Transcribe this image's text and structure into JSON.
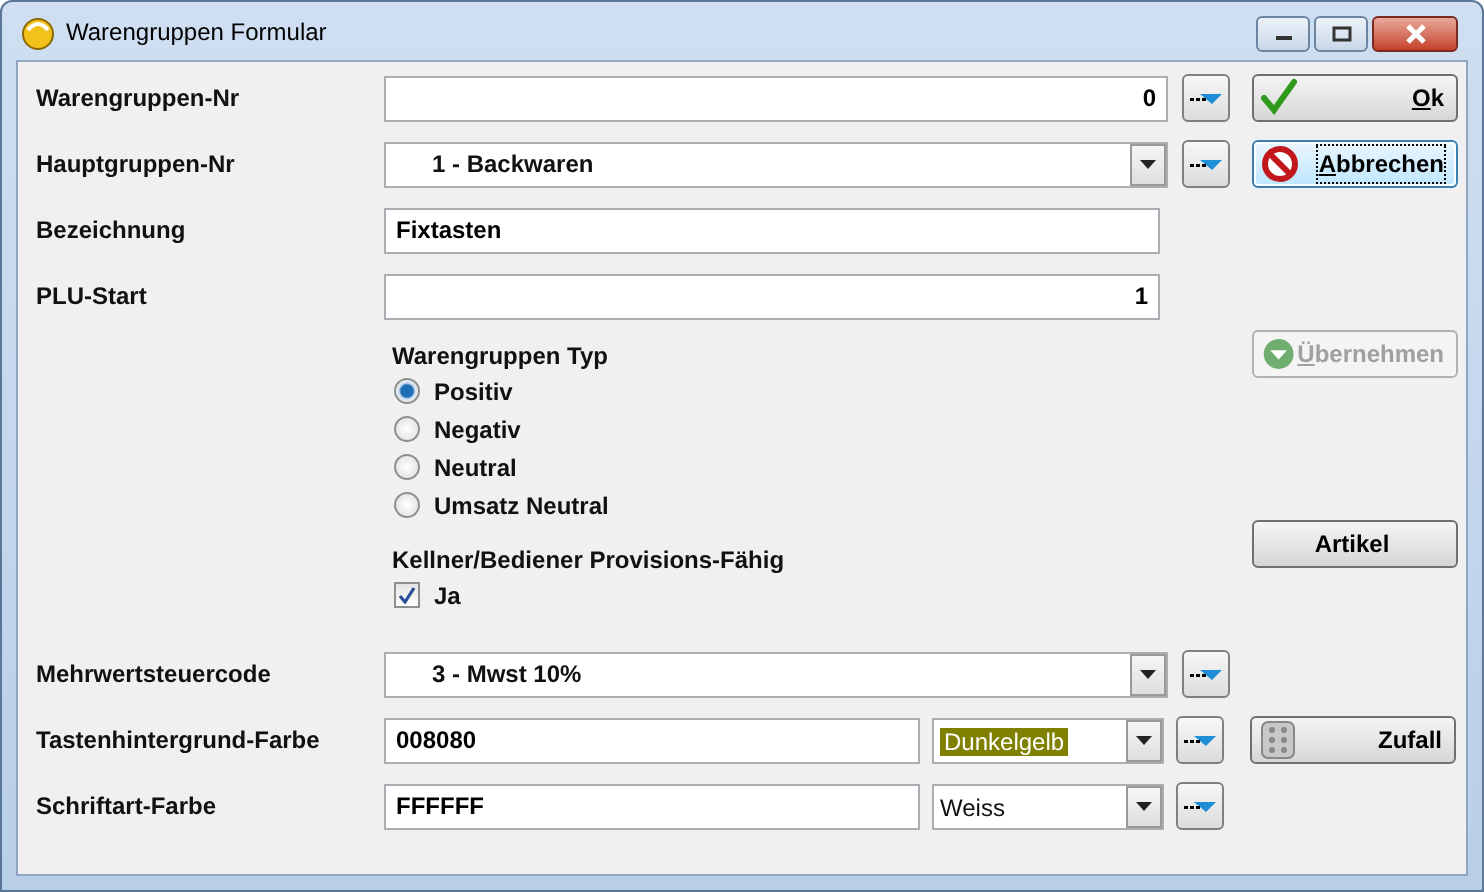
{
  "window": {
    "title": "Warengruppen Formular"
  },
  "top_rows": [
    {
      "label": "Warengruppen-Nr",
      "fields": [
        {
          "kind": "number",
          "value": "0"
        }
      ],
      "lookup": true,
      "button": {
        "label": "Ok",
        "kind": "check",
        "mnemonic": true
      }
    },
    {
      "label": "Hauptgruppen-Nr",
      "fields": [
        {
          "kind": "combo",
          "value": "1 - Backwaren"
        }
      ],
      "lookup": true,
      "button": {
        "label": "Abbrechen",
        "kind": "cancel",
        "mnemonic": true,
        "focused": true
      }
    },
    {
      "label": "Bezeichnung",
      "fields": [
        {
          "kind": "text",
          "value": "Fixtasten"
        }
      ]
    },
    {
      "label": "PLU-Start",
      "fields": [
        {
          "kind": "number",
          "value": "1"
        }
      ]
    }
  ],
  "apply_button": {
    "label": "Übernehmen",
    "kind": "down",
    "mnemonic": true,
    "disabled": true
  },
  "type_group": {
    "title": "Warengruppen Typ",
    "options": [
      {
        "label": "Positiv",
        "selected": true
      },
      {
        "label": "Negativ",
        "selected": false
      },
      {
        "label": "Neutral",
        "selected": false
      },
      {
        "label": "Umsatz Neutral",
        "selected": false
      }
    ]
  },
  "provision_group": {
    "title": "Kellner/Bediener Provisions-Fähig",
    "options": [
      {
        "label": "Ja",
        "checked": true
      }
    ]
  },
  "articles_button": {
    "label": "Artikel"
  },
  "bottom_rows": [
    {
      "label": "Mehrwertsteuercode",
      "fields": [
        {
          "kind": "combo",
          "value": "3 - Mwst 10%"
        }
      ],
      "lookup": true
    },
    {
      "label": "Tastenhintergrund-Farbe",
      "fields": [
        {
          "kind": "text",
          "value": "008080"
        },
        {
          "kind": "color-combo",
          "value": "Dunkelgelb",
          "color": "#808000"
        }
      ],
      "lookup": true,
      "button": {
        "label": "Zufall",
        "kind": "dice"
      }
    },
    {
      "label": "Schriftart-Farbe",
      "fields": [
        {
          "kind": "text",
          "value": "FFFFFF"
        },
        {
          "kind": "color-combo",
          "value": "Weiss"
        }
      ],
      "lookup": true
    }
  ]
}
